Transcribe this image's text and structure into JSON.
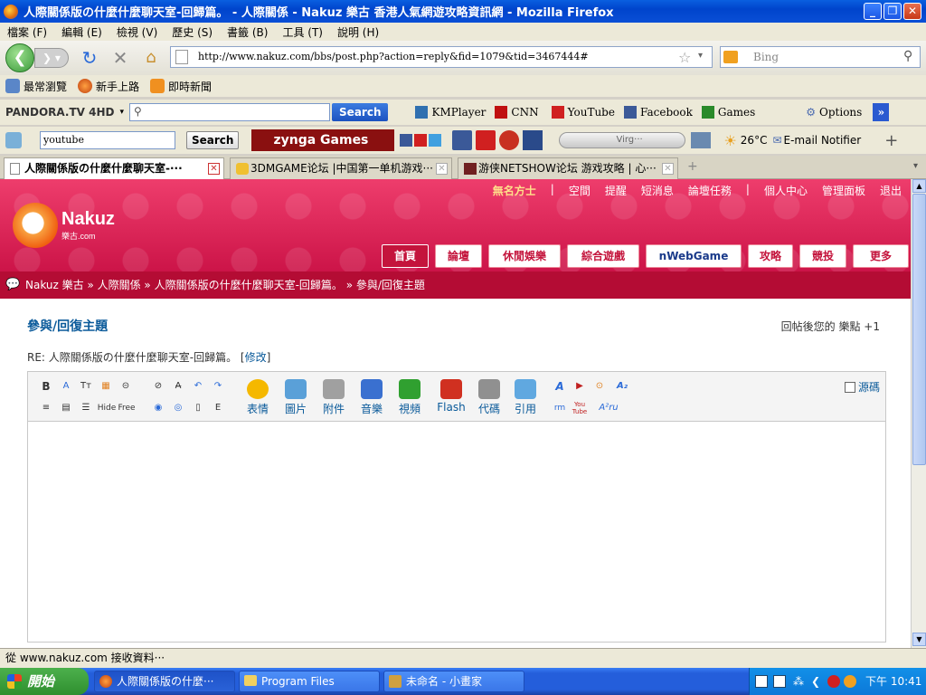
{
  "window": {
    "title": "人際關係版の什麼什麼聊天室-回歸篇。 - 人際關係 - Nakuz 樂古 香港人氣網遊攻略資訊網 - Mozilla Firefox",
    "minimize": "_",
    "maximize": "❐",
    "close": "✕"
  },
  "menu": [
    "檔案 (F)",
    "編輯 (E)",
    "檢視 (V)",
    "歷史 (S)",
    "書籤 (B)",
    "工具 (T)",
    "說明 (H)"
  ],
  "nav": {
    "url": "http://www.nakuz.com/bbs/post.php?action=reply&fid=1079&tid=3467444#",
    "search_placeholder": "Bing"
  },
  "bookmarks": [
    "最常瀏覽",
    "新手上路",
    "即時新聞"
  ],
  "toolbar1": {
    "pandora": "PANDORA.TV 4HD",
    "ask_search": "Search",
    "kmplayer": "KMPlayer",
    "cnn": "CNN",
    "youtube": "YouTube",
    "facebook": "Facebook",
    "games": "Games",
    "options": "Options"
  },
  "toolbar2": {
    "search_value": "youtube",
    "search_btn": "Search",
    "zynga": "zynga Games",
    "player": "Virg···",
    "weather": "26°C",
    "email": "E-mail Notifier"
  },
  "tabs": [
    {
      "label": "人際關係版の什麼什麼聊天室-···"
    },
    {
      "label": "3DMGAME论坛 |中国第一单机游戏···"
    },
    {
      "label": "游侠NETSHOW论坛 游戏攻略 | 心···"
    }
  ],
  "site": {
    "toplinks": [
      "無名方士",
      "|",
      "空間",
      "提醒",
      "短消息",
      "論壇任務",
      "|",
      "個人中心",
      "管理面板",
      "退出"
    ],
    "logo": "Nakuz",
    "logo_sub": "樂古.com",
    "navtabs": [
      "首頁",
      "論壇",
      "休閒娛樂",
      "綜合遊戲",
      "nWebGame",
      "攻略",
      "競投",
      "更多"
    ],
    "breadcrumb": "Nakuz 樂古 » 人際關係 » 人際關係版の什麼什麼聊天室-回歸篇。 » 參與/回復主題",
    "section_title": "參與/回復主題",
    "reward": "回帖後您的 樂點 +1",
    "re_prefix": "RE: 人際關係版の什麼什麼聊天室-回歸篇。 [",
    "re_edit": "修改",
    "re_suffix": "]"
  },
  "editor": {
    "small_tools_row1": [
      "B",
      "A",
      "Tт",
      "▦",
      "⊝",
      "⊘",
      "A̶",
      "↶",
      "↷"
    ],
    "small_tools_row2": [
      "≡",
      "▤",
      "☰",
      "Hide",
      "Free",
      "◉",
      "◎",
      "▯",
      "E"
    ],
    "big_tools": [
      {
        "label": "表情",
        "color": "#f5b800"
      },
      {
        "label": "圖片",
        "color": "#5aa0d8"
      },
      {
        "label": "附件",
        "color": "#a0a0a0"
      },
      {
        "label": "音樂",
        "color": "#3a70d0"
      },
      {
        "label": "視頻",
        "color": "#30a030"
      },
      {
        "label": "Flash",
        "color": "#d03020"
      },
      {
        "label": "代碼",
        "color": "#909090"
      },
      {
        "label": "引用",
        "color": "#60a8e0"
      }
    ],
    "right_tools": [
      "A",
      "▶",
      "⊙",
      "A₂",
      "rm",
      "You Tube",
      "A²ru"
    ],
    "source_code": "源碼"
  },
  "status": "從 www.nakuz.com 接收資料···",
  "taskbar": {
    "start": "開始",
    "tasks": [
      "人際關係版の什麼···",
      "Program Files",
      "未命名 - 小畫家"
    ],
    "clock": "下午 10:41"
  }
}
